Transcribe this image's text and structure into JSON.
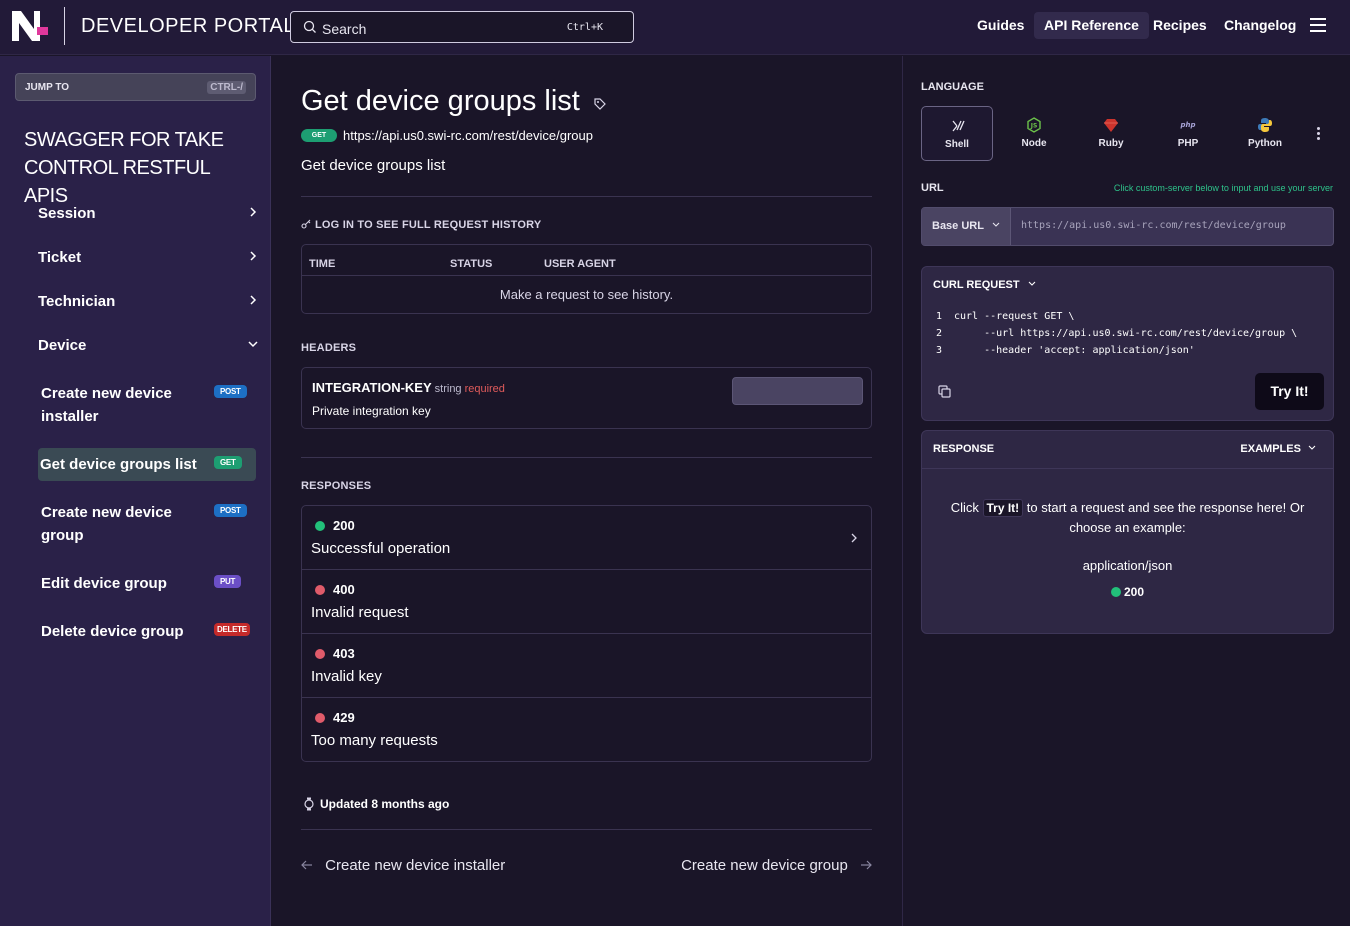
{
  "header": {
    "portal_title": "DEVELOPER PORTAL",
    "search_placeholder": "Search",
    "search_shortcut": "Ctrl+K",
    "nav": [
      "Guides",
      "API Reference",
      "Recipes",
      "Changelog"
    ],
    "active_nav": "API Reference"
  },
  "sidebar": {
    "jump_label": "JUMP TO",
    "jump_shortcut": "CTRL-/",
    "title": "SWAGGER FOR TAKE CONTROL RESTFUL APIS",
    "sections": [
      {
        "label": "Session",
        "expanded": false
      },
      {
        "label": "Ticket",
        "expanded": false
      },
      {
        "label": "Technician",
        "expanded": false
      },
      {
        "label": "Device",
        "expanded": true
      }
    ],
    "items": [
      {
        "label": "Create new device installer",
        "method": "POST"
      },
      {
        "label": "Get device groups list",
        "method": "GET",
        "active": true
      },
      {
        "label": "Create new device group",
        "method": "POST"
      },
      {
        "label": "Edit device group",
        "method": "PUT"
      },
      {
        "label": "Delete device group",
        "method": "DELETE"
      }
    ]
  },
  "main": {
    "title": "Get device groups list",
    "method": "GET",
    "endpoint": "https://api.us0.swi-rc.com/rest/device/group",
    "description": "Get device groups list",
    "history": {
      "label": "LOG IN TO SEE FULL REQUEST HISTORY",
      "columns": [
        "TIME",
        "STATUS",
        "USER AGENT"
      ],
      "empty_text": "Make a request to see history."
    },
    "headers": {
      "label": "HEADERS",
      "name": "INTEGRATION-KEY",
      "type": "string",
      "required": "required",
      "description": "Private integration key"
    },
    "responses": {
      "label": "RESPONSES",
      "items": [
        {
          "code": "200",
          "desc": "Successful operation",
          "status": "success"
        },
        {
          "code": "400",
          "desc": "Invalid request",
          "status": "error"
        },
        {
          "code": "403",
          "desc": "Invalid key",
          "status": "error"
        },
        {
          "code": "429",
          "desc": "Too many requests",
          "status": "error"
        }
      ]
    },
    "updated": "Updated 8 months ago",
    "prev_page": "Create new device installer",
    "next_page": "Create new device group"
  },
  "right": {
    "language_label": "LANGUAGE",
    "languages": [
      "Shell",
      "Node",
      "Ruby",
      "PHP",
      "Python"
    ],
    "active_language": "Shell",
    "url_label": "URL",
    "url_hint": "Click custom-server below to input and use your server",
    "base_url_label": "Base URL",
    "url_value": "https://api.us0.swi-rc.com/rest/device/group",
    "curl_label": "CURL REQUEST",
    "code_lines": [
      "curl --request GET \\",
      "     --url https://api.us0.swi-rc.com/rest/device/group \\",
      "     --header 'accept: application/json'"
    ],
    "try_label": "Try It!",
    "response_label": "RESPONSE",
    "examples_label": "EXAMPLES",
    "response_msg_before": "Click",
    "response_msg_after": "to start a request and see the response here! Or choose an example:",
    "example_type": "application/json",
    "example_code": "200"
  },
  "colors": {
    "background": "#1a1528",
    "sidebar": "#2a2148",
    "get": "#1d9e72",
    "post": "#1d6fc4",
    "put": "#6b4fc6",
    "delete": "#c42a2a",
    "success": "#22c07a",
    "error": "#e05b6a"
  }
}
